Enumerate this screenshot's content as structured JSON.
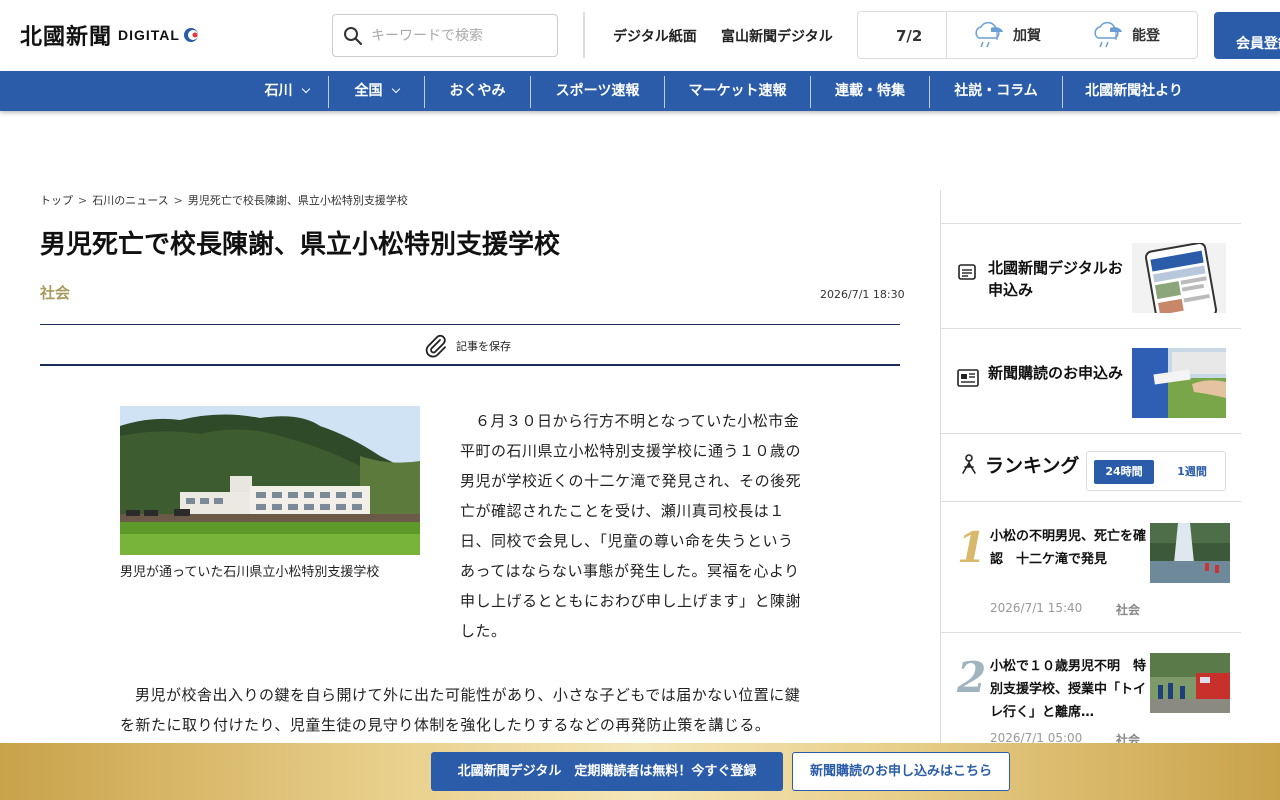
{
  "header": {
    "logo_text": "北國新聞",
    "logo_digital": "DIGITAL",
    "search_placeholder": "キーワードで検索",
    "links": [
      "デジタル紙面",
      "富山新聞デジタル"
    ],
    "weather": {
      "date": "7/2",
      "locations": [
        {
          "name": "加賀",
          "icon": "cloud-rain-icon"
        },
        {
          "name": "能登",
          "icon": "cloud-rain-icon"
        }
      ]
    },
    "member_button": "会員登録"
  },
  "nav": {
    "items": [
      "石川",
      "全国",
      "おくやみ",
      "スポーツ速報",
      "マーケット速報",
      "連載・特集",
      "社説・コラム",
      "北國新聞社より"
    ]
  },
  "breadcrumb": [
    "トップ",
    "石川のニュース",
    "男児死亡で校長陳謝、県立小松特別支援学校"
  ],
  "article": {
    "title": "男児死亡で校長陳謝、県立小松特別支援学校",
    "category": "社会",
    "date": "2026/7/1 18:30",
    "save_label": "記事を保存",
    "caption": "男児が通っていた石川県立小松特別支援学校",
    "paragraph1": "６月３０日から行方不明となっていた小松市金平町の石川県立小松特別支援学校に通う１０歳の男児が学校近くの十二ケ滝で発見され、その後死亡が確認されたことを受け、瀬川真司校長は１日、同校で会見し、「児童の尊い命を失うというあってはならない事態が発生した。冥福を心より申し上げるとともにおわび申し上げます」と陳謝した。",
    "paragraph2": "男児が校舎出入りの鍵を自ら開けて外に出た可能性があり、小さな子どもでは届かない位置に鍵を新たに取り付けたり、児童生徒の見守り体制を強化したりするなどの再発防止策を講じる。"
  },
  "sidebar": {
    "promos": [
      {
        "label": "北國新聞デジタルお申込み",
        "icon": "document-list-icon"
      },
      {
        "label": "新聞購読のお申込み",
        "icon": "newspaper-icon"
      }
    ],
    "ranking": {
      "title": "ランキング",
      "tabs": [
        "24時間",
        "1週間"
      ],
      "active_tab": "24時間",
      "items": [
        {
          "rank": "1",
          "title": "小松の不明男児、死亡を確認　十二ケ滝で発見",
          "date": "2026/7/1 15:40",
          "category": "社会"
        },
        {
          "rank": "2",
          "title": "小松で１０歳男児不明　特別支援学校、授業中「トイレ行く」と離席…",
          "date": "2026/7/1 05:00",
          "category": "社会"
        }
      ]
    }
  },
  "bottom_bar": {
    "cta_primary": "北國新聞デジタル　定期購読者は無料！今すぐ登録",
    "cta_secondary": "新聞購読のお申し込みはこちら"
  },
  "colors": {
    "brand_blue": "#2a5caa",
    "category_gold": "#a89a5e",
    "rank1": "#d8b86a",
    "rank2": "#9fb4bf"
  }
}
